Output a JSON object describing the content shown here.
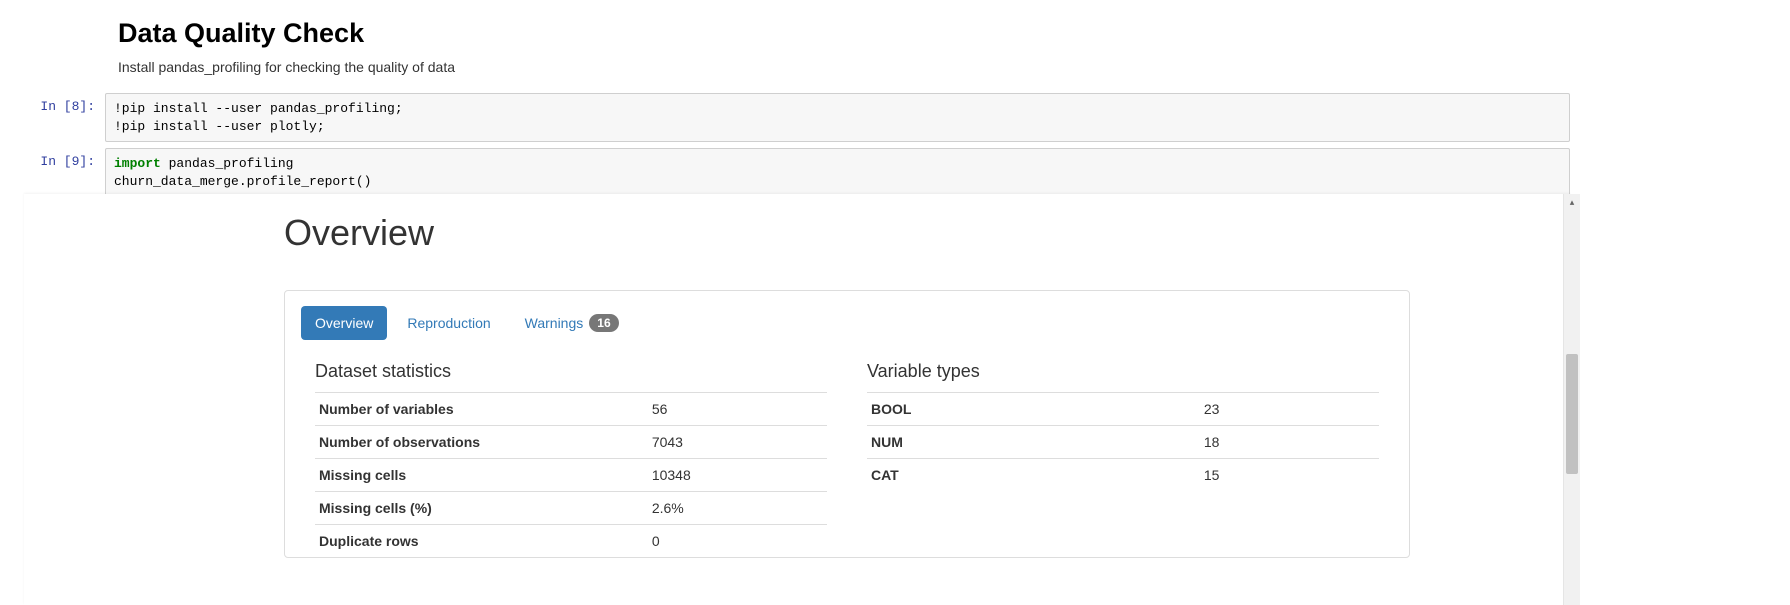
{
  "markdown": {
    "heading": "Data Quality Check",
    "body": "Install pandas_profiling for checking the quality of data"
  },
  "cells": [
    {
      "prompt": "In [8]:",
      "code_plain": "!pip install --user pandas_profiling;\n!pip install --user plotly;"
    },
    {
      "prompt": "In [9]:",
      "code_import_kw": "import",
      "code_import_rest": " pandas_profiling",
      "code_line2": "churn_data_merge.profile_report()"
    }
  ],
  "report": {
    "title": "Overview",
    "tabs": {
      "overview": "Overview",
      "reproduction": "Reproduction",
      "warnings": "Warnings",
      "warnings_count": "16"
    },
    "dataset_stats_heading": "Dataset statistics",
    "variable_types_heading": "Variable types",
    "dataset_stats": [
      {
        "label": "Number of variables",
        "value": "56"
      },
      {
        "label": "Number of observations",
        "value": "7043"
      },
      {
        "label": "Missing cells",
        "value": "10348"
      },
      {
        "label": "Missing cells (%)",
        "value": "2.6%"
      },
      {
        "label": "Duplicate rows",
        "value": "0"
      }
    ],
    "variable_types": [
      {
        "label": "BOOL",
        "value": "23"
      },
      {
        "label": "NUM",
        "value": "18"
      },
      {
        "label": "CAT",
        "value": "15"
      }
    ]
  }
}
